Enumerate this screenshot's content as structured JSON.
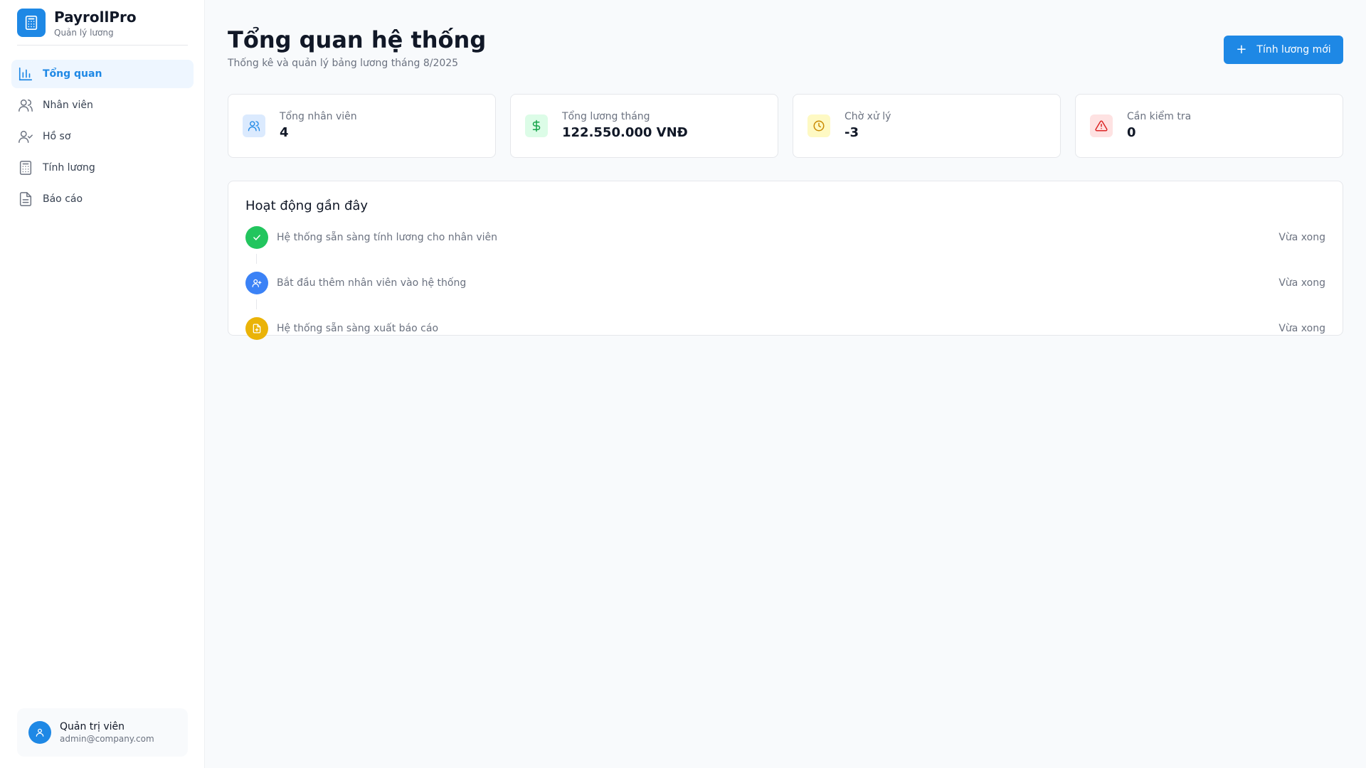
{
  "brand": {
    "name": "PayrollPro",
    "subtitle": "Quản lý lương",
    "icon": "calculator-icon"
  },
  "nav": {
    "items": [
      {
        "label": "Tổng quan",
        "icon": "bar-chart-icon",
        "active": true
      },
      {
        "label": "Nhân viên",
        "icon": "users-icon",
        "active": false
      },
      {
        "label": "Hồ sơ",
        "icon": "user-check-icon",
        "active": false
      },
      {
        "label": "Tính lương",
        "icon": "calculator-icon",
        "active": false
      },
      {
        "label": "Báo cáo",
        "icon": "file-text-icon",
        "active": false
      }
    ]
  },
  "user": {
    "name": "Quản trị viên",
    "email": "admin@company.com",
    "icon": "user-icon"
  },
  "header": {
    "title": "Tổng quan hệ thống",
    "subtitle": "Thống kê và quản lý bảng lương tháng 8/2025",
    "new_button": "Tính lương mới",
    "new_button_icon": "plus-icon"
  },
  "stats": [
    {
      "label": "Tổng nhân viên",
      "value": "4",
      "icon": "users-icon",
      "color": "#1e88e5",
      "bg": "#dbeafe"
    },
    {
      "label": "Tổng lương tháng",
      "value": "122.550.000 VNĐ",
      "icon": "dollar-icon",
      "color": "#16a34a",
      "bg": "#dcfce7"
    },
    {
      "label": "Chờ xử lý",
      "value": "-3",
      "icon": "clock-icon",
      "color": "#ca8a04",
      "bg": "#fef9c3"
    },
    {
      "label": "Cần kiểm tra",
      "value": "0",
      "icon": "alert-triangle-icon",
      "color": "#dc2626",
      "bg": "#fee2e2"
    }
  ],
  "activity": {
    "title": "Hoạt động gần đây",
    "items": [
      {
        "text": "Hệ thống sẵn sàng tính lương cho nhân viên",
        "time": "Vừa xong",
        "icon": "check-icon",
        "color": "#22c55e"
      },
      {
        "text": "Bắt đầu thêm nhân viên vào hệ thống",
        "time": "Vừa xong",
        "icon": "user-plus-icon",
        "color": "#3b82f6"
      },
      {
        "text": "Hệ thống sẵn sàng xuất báo cáo",
        "time": "Vừa xong",
        "icon": "file-plus-icon",
        "color": "#eab308"
      }
    ]
  }
}
